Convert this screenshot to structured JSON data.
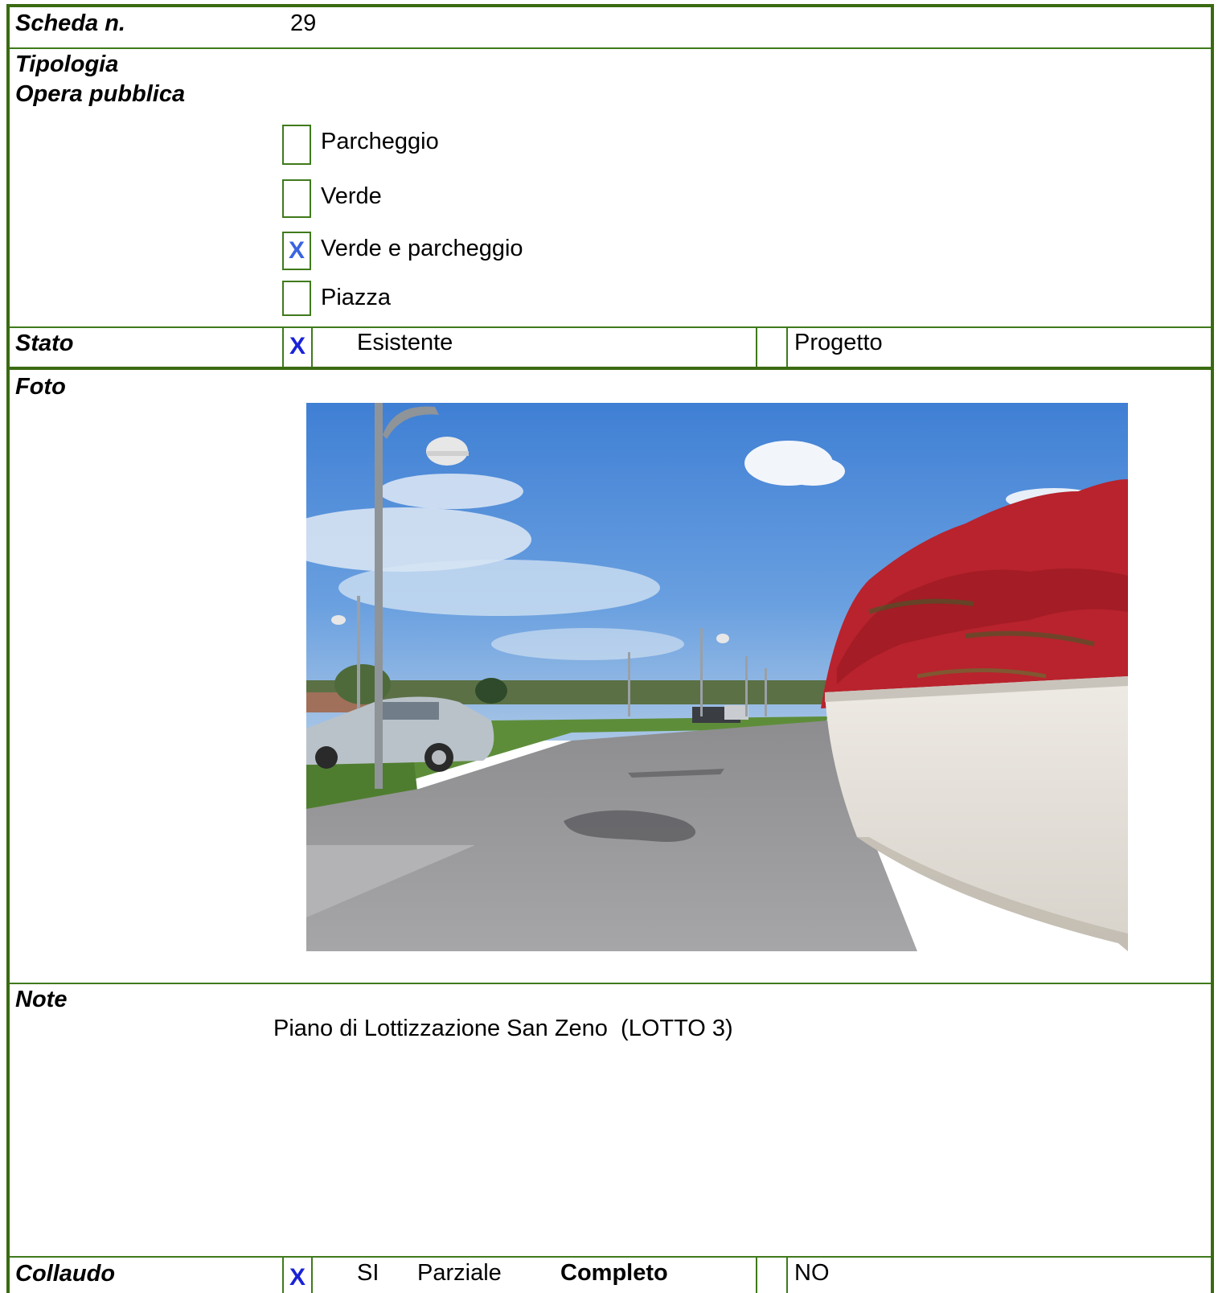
{
  "header": {
    "label": "Scheda n.",
    "value": "29"
  },
  "tipologia": {
    "label_1": "Tipologia",
    "label_2": "Opera pubblica",
    "options": [
      {
        "label": "Parcheggio",
        "mark": ""
      },
      {
        "label": "Verde",
        "mark": ""
      },
      {
        "label": "Verde e parcheggio",
        "mark": "X"
      },
      {
        "label": "Piazza",
        "mark": ""
      }
    ]
  },
  "stato": {
    "label": "Stato",
    "mark": "X",
    "option_1": "Esistente",
    "option_2": "Progetto"
  },
  "foto": {
    "label": "Foto"
  },
  "note": {
    "label": "Note",
    "text": "Piano di Lottizzazione San Zeno  (LOTTO 3)"
  },
  "collaudo": {
    "label": "Collaudo",
    "mark": "X",
    "si": "SI",
    "parziale": "Parziale",
    "completo": "Completo",
    "no": "NO"
  },
  "colors": {
    "border": "#3f7a1c",
    "mark": "#1a22d8"
  }
}
